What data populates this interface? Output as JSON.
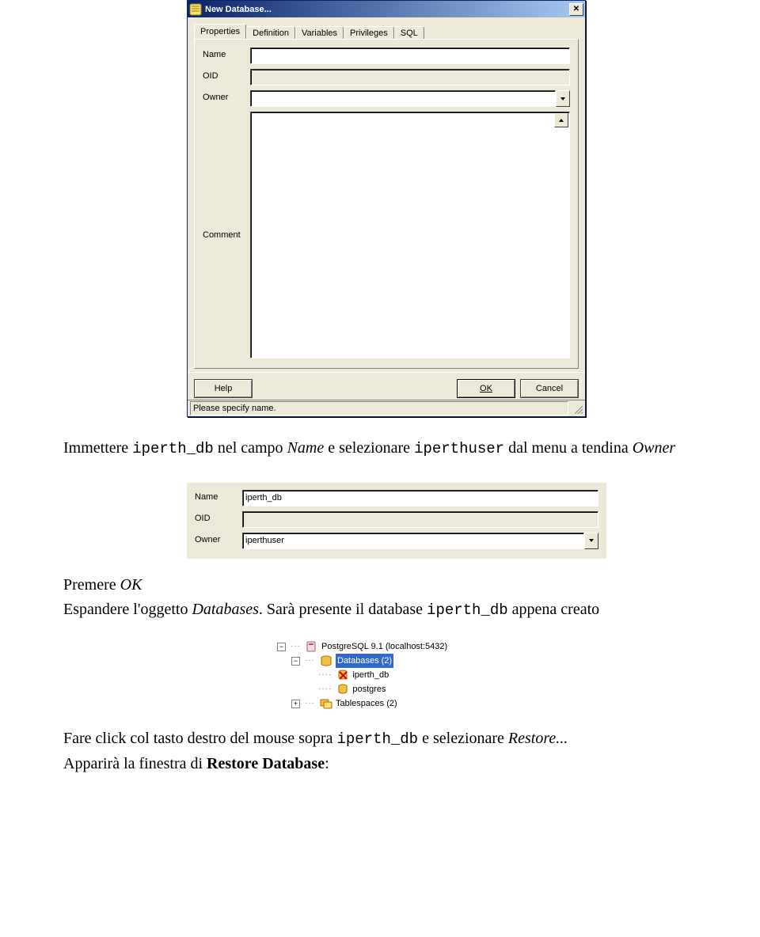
{
  "dialog": {
    "title": "New Database...",
    "tabs": [
      "Properties",
      "Definition",
      "Variables",
      "Privileges",
      "SQL"
    ],
    "active_tab": 0,
    "fields": {
      "name_label": "Name",
      "oid_label": "OID",
      "owner_label": "Owner",
      "comment_label": "Comment",
      "name_value": "",
      "oid_value": "",
      "owner_value": "",
      "comment_value": ""
    },
    "buttons": {
      "help": "Help",
      "ok": "OK",
      "cancel": "Cancel"
    },
    "status": "Please specify name."
  },
  "prose1": {
    "prefix": "Immettere ",
    "code1": "iperth_db",
    "mid1": " nel campo ",
    "em1": "Name",
    "mid2": " e selezionare ",
    "code2": "iperthuser",
    "mid3": " dal menu a tendina ",
    "em2": "Owner"
  },
  "snippet": {
    "name_label": "Name",
    "oid_label": "OID",
    "owner_label": "Owner",
    "name_value": "iperth_db",
    "oid_value": "",
    "owner_value": "iperthuser"
  },
  "prose2_line1": {
    "prefix": "Premere ",
    "em": "OK"
  },
  "prose2_line2": {
    "prefix": "Espandere l'oggetto ",
    "em": "Databases",
    "mid": ". Sarà presente il database ",
    "code": "iperth_db",
    "suffix": " appena creato"
  },
  "tree": {
    "server": "PostgreSQL 9.1 (localhost:5432)",
    "databases": "Databases (2)",
    "db1": "iperth_db",
    "db2": "postgres",
    "tablespaces": "Tablespaces (2)"
  },
  "prose3": {
    "prefix": "Fare click col tasto destro del mouse sopra ",
    "code": "iperth_db",
    "mid": " e selezionare ",
    "em": "Restore...",
    "line2_prefix": "Apparirà la finestra di ",
    "line2_bold": "Restore Database",
    "line2_suffix": ":"
  }
}
